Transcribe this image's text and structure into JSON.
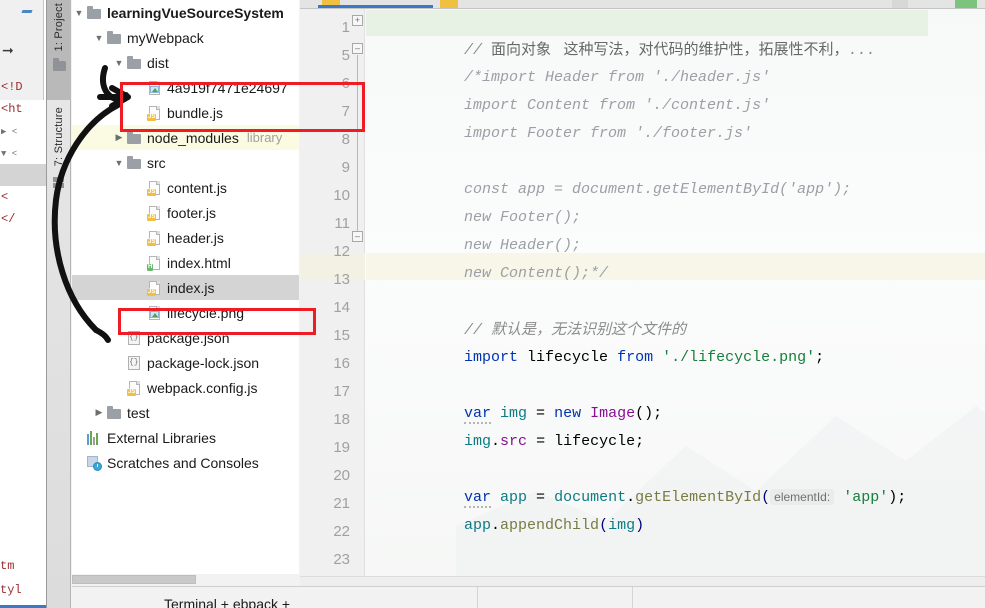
{
  "app": {
    "ide_name": "IntelliJ IDEA / WebStorm Project View"
  },
  "rail": {
    "project_tab": "1: Project",
    "structure_tab": "7: Structure"
  },
  "tree": {
    "items": [
      {
        "label": "learningVueSourceSystem",
        "icon": "folder-icon",
        "indent": 14,
        "twig": "▼",
        "bold": true,
        "type": "folder",
        "sub": ""
      },
      {
        "label": "myWebpack",
        "icon": "folder-icon",
        "indent": 34,
        "twig": "▼",
        "bold": false,
        "type": "folder",
        "sub": ""
      },
      {
        "label": "dist",
        "icon": "folder-icon",
        "indent": 54,
        "twig": "▼",
        "bold": false,
        "type": "folder",
        "sub": ""
      },
      {
        "label": "4a919f7471e24697",
        "icon": "image-file-icon",
        "indent": 74,
        "twig": "",
        "bold": false,
        "type": "image",
        "sub": ""
      },
      {
        "label": "bundle.js",
        "icon": "js-file-icon",
        "indent": 74,
        "twig": "",
        "bold": false,
        "type": "js",
        "sub": ""
      },
      {
        "label": "node_modules",
        "icon": "folder-icon",
        "indent": 54,
        "twig": "▶",
        "bold": false,
        "type": "folder",
        "sub": "library",
        "highlight": "yellow"
      },
      {
        "label": "src",
        "icon": "folder-icon",
        "indent": 54,
        "twig": "▼",
        "bold": false,
        "type": "folder",
        "sub": ""
      },
      {
        "label": "content.js",
        "icon": "js-file-icon",
        "indent": 74,
        "twig": "",
        "bold": false,
        "type": "js",
        "sub": ""
      },
      {
        "label": "footer.js",
        "icon": "js-file-icon",
        "indent": 74,
        "twig": "",
        "bold": false,
        "type": "js",
        "sub": ""
      },
      {
        "label": "header.js",
        "icon": "js-file-icon",
        "indent": 74,
        "twig": "",
        "bold": false,
        "type": "js",
        "sub": ""
      },
      {
        "label": "index.html",
        "icon": "html-file-icon",
        "indent": 74,
        "twig": "",
        "bold": false,
        "type": "html",
        "sub": ""
      },
      {
        "label": "index.js",
        "icon": "js-file-icon",
        "indent": 74,
        "twig": "",
        "bold": false,
        "type": "js",
        "sub": "",
        "highlight": "selected"
      },
      {
        "label": "lifecycle.png",
        "icon": "image-file-icon",
        "indent": 74,
        "twig": "",
        "bold": false,
        "type": "image",
        "sub": ""
      },
      {
        "label": "package.json",
        "icon": "json-file-icon",
        "indent": 54,
        "twig": "",
        "bold": false,
        "type": "json",
        "sub": ""
      },
      {
        "label": "package-lock.json",
        "icon": "json-file-icon",
        "indent": 54,
        "twig": "",
        "bold": false,
        "type": "json",
        "sub": ""
      },
      {
        "label": "webpack.config.js",
        "icon": "js-file-icon",
        "indent": 54,
        "twig": "",
        "bold": false,
        "type": "js",
        "sub": ""
      },
      {
        "label": "test",
        "icon": "folder-icon",
        "indent": 34,
        "twig": "▶",
        "bold": false,
        "type": "folder",
        "sub": ""
      },
      {
        "label": "External Libraries",
        "icon": "library-icon",
        "indent": 14,
        "twig": "",
        "bold": false,
        "type": "library",
        "sub": ""
      },
      {
        "label": "Scratches and Consoles",
        "icon": "scratches-icon",
        "indent": 14,
        "twig": "",
        "bold": false,
        "type": "scratch",
        "sub": ""
      }
    ]
  },
  "editor": {
    "line_numbers": [
      "1",
      "5",
      "6",
      "7",
      "8",
      "9",
      "10",
      "11",
      "12",
      "13",
      "14",
      "15",
      "16",
      "17",
      "18",
      "19",
      "20",
      "21",
      "22",
      "23"
    ],
    "caret_line": "13",
    "lines": [
      {
        "n": "1",
        "kind": "comment-folded"
      },
      {
        "n": "5",
        "kind": "code"
      },
      {
        "n": "6",
        "kind": "code"
      },
      {
        "n": "7",
        "kind": "code"
      },
      {
        "n": "8",
        "kind": "blank"
      },
      {
        "n": "9",
        "kind": "code"
      },
      {
        "n": "10",
        "kind": "code"
      },
      {
        "n": "11",
        "kind": "code"
      },
      {
        "n": "12",
        "kind": "code"
      },
      {
        "n": "13",
        "kind": "blank"
      },
      {
        "n": "14",
        "kind": "comment"
      },
      {
        "n": "15",
        "kind": "code"
      },
      {
        "n": "16",
        "kind": "blank"
      },
      {
        "n": "17",
        "kind": "code"
      },
      {
        "n": "18",
        "kind": "code"
      },
      {
        "n": "19",
        "kind": "blank"
      },
      {
        "n": "20",
        "kind": "code"
      },
      {
        "n": "21",
        "kind": "code"
      },
      {
        "n": "22",
        "kind": "blank"
      },
      {
        "n": "23",
        "kind": "blank"
      }
    ],
    "text": {
      "l1_comment_slashes": "// ",
      "l1_comment_cn": "面向对象   这种写法，对代码的维护性，拓展性不利，",
      "l1_ellipsis": "...",
      "l5": "/*import Header from './header.js'",
      "l6": "import Content from './content.js'",
      "l7": "import Footer from './footer.js'",
      "l9": "const app = document.getElementById('app');",
      "l10": "new Footer();",
      "l11": "new Header();",
      "l12": "new Content();*/",
      "l14_slashes": "// ",
      "l14_cn": "默认是，无法识别这个文件的",
      "l15_kw_import": "import",
      "l15_ident": " lifecycle ",
      "l15_kw_from": "from",
      "l15_str": " './lifecycle.png'",
      "l15_semi": ";",
      "l17_kw_var": "var",
      "l17_ident_img": " img ",
      "l17_eq": "= ",
      "l17_kw_new": "new",
      "l17_cls_image": " Image",
      "l17_tail": "();",
      "l18_img": "img",
      "l18_dot": ".",
      "l18_src": "src",
      "l18_eq": " = ",
      "l18_lifecycle": "lifecycle",
      "l18_semi": ";",
      "l20_kw_var": "var",
      "l20_ident_app": " app ",
      "l20_eq": "= ",
      "l20_document": "document",
      "l20_dot": ".",
      "l20_fn": "getElementById",
      "l20_paren": "(",
      "l20_hint": "elementId:",
      "l20_str": " 'app'",
      "l20_tail": ");",
      "l21_app": "app",
      "l21_dot": ".",
      "l21_fn": "appendChild",
      "l21_paren_open": "(",
      "l21_arg": "img",
      "l21_paren_close": ")"
    }
  },
  "background_window": {
    "fragments": [
      "<!D",
      "<ht",
      "▶ <",
      "▼ <",
      "<",
      "</",
      "tm",
      "tyl"
    ]
  },
  "status": {
    "terminal_label": "Terminal   +   ebpack   +"
  },
  "annotations": {
    "redbox_dist_files": {
      "note": "red rectangle around 4a919f7471e24697 and bundle.js"
    },
    "redbox_lifecycle": {
      "note": "red rectangle around lifecycle.png"
    },
    "arrow": {
      "note": "hand-drawn black arrow pointing from lifecycle.png up to dist output files"
    }
  },
  "colors": {
    "annotation_red": "#ee1c25",
    "keyword_blue": "#0033b3",
    "string_green": "#157f3b",
    "comment_gray": "#8c8c8c",
    "selection_gray": "#d4d4d4",
    "library_yellow": "#fbfbe3",
    "caret_line": "#f7f6e8",
    "tab_active": "#3a78c8"
  }
}
